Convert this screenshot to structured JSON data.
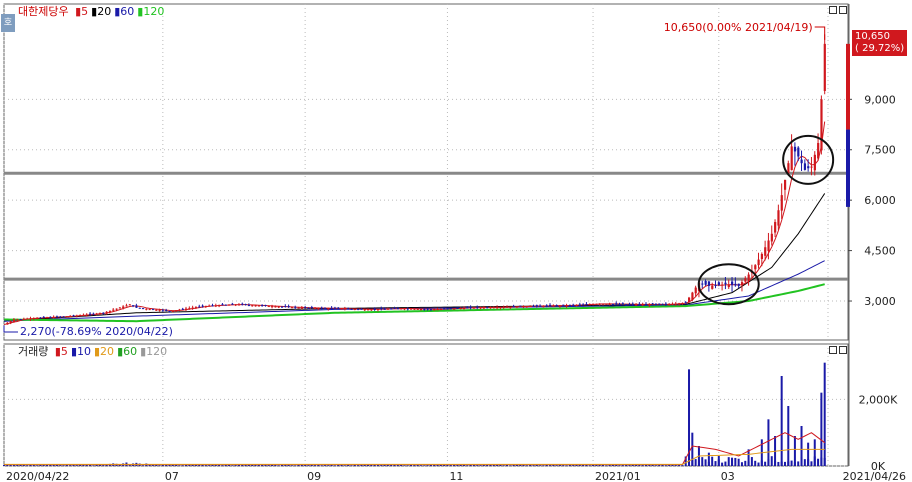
{
  "stock": {
    "name": "대한제당우"
  },
  "price_legend": [
    {
      "label": "5",
      "color": "#d0181e"
    },
    {
      "label": "20",
      "color": "#000000"
    },
    {
      "label": "60",
      "color": "#1a1aa8"
    },
    {
      "label": "120",
      "color": "#22c322"
    }
  ],
  "volume_legend": {
    "title": "거래량",
    "items": [
      {
        "label": "5",
        "color": "#d0181e"
      },
      {
        "label": "10",
        "color": "#1a1aa8"
      },
      {
        "label": "20",
        "color": "#e09a1a"
      },
      {
        "label": "60",
        "color": "#22a022"
      },
      {
        "label": "120",
        "color": "#999999"
      }
    ]
  },
  "annotations": {
    "high": "10,650(0.00% 2021/04/19)",
    "low": "2,270(-78.69% 2020/04/22)"
  },
  "price_tag": {
    "line1": "10,650",
    "line2": "( 29.72%)"
  },
  "corner_icon": "호",
  "chart_data": [
    {
      "type": "candlestick",
      "y_ticks": [
        "9,000",
        "7,500",
        "6,000",
        "4,500",
        "3,000"
      ],
      "y_tick_values": [
        9000,
        7500,
        6000,
        4500,
        3000
      ],
      "ylim": [
        1900,
        11300
      ],
      "x_ticks": [
        "2020/04/22",
        "07",
        "09",
        "11",
        "2021/01",
        "03",
        "2021/04/26"
      ],
      "x_tick_index": [
        0,
        48,
        91,
        134,
        178,
        216,
        249
      ],
      "horizontal_lines": [
        6800,
        3650
      ],
      "close_points": [
        [
          0,
          2300
        ],
        [
          3,
          2450
        ],
        [
          10,
          2500
        ],
        [
          20,
          2550
        ],
        [
          30,
          2650
        ],
        [
          38,
          2900
        ],
        [
          40,
          2800
        ],
        [
          50,
          2700
        ],
        [
          60,
          2850
        ],
        [
          70,
          2900
        ],
        [
          80,
          2850
        ],
        [
          90,
          2800
        ],
        [
          100,
          2780
        ],
        [
          110,
          2750
        ],
        [
          120,
          2780
        ],
        [
          130,
          2750
        ],
        [
          140,
          2800
        ],
        [
          150,
          2820
        ],
        [
          160,
          2850
        ],
        [
          170,
          2870
        ],
        [
          180,
          2920
        ],
        [
          190,
          2900
        ],
        [
          200,
          2900
        ],
        [
          206,
          2950
        ],
        [
          210,
          3550
        ],
        [
          213,
          3450
        ],
        [
          218,
          3500
        ],
        [
          222,
          3450
        ],
        [
          226,
          3900
        ],
        [
          229,
          4400
        ],
        [
          232,
          5000
        ],
        [
          234,
          5700
        ],
        [
          236,
          6600
        ],
        [
          238,
          7600
        ],
        [
          240,
          7300
        ],
        [
          242,
          6900
        ],
        [
          244,
          7000
        ],
        [
          246,
          7700
        ],
        [
          247,
          9000
        ],
        [
          248,
          10650
        ]
      ],
      "ma": [
        {
          "label": "20",
          "points": [
            [
              0,
              2400
            ],
            [
              40,
              2650
            ],
            [
              100,
              2780
            ],
            [
              206,
              2900
            ],
            [
              220,
              3250
            ],
            [
              232,
              4000
            ],
            [
              240,
              5000
            ],
            [
              248,
              6200
            ]
          ]
        },
        {
          "label": "60",
          "points": [
            [
              0,
              2400
            ],
            [
              40,
              2550
            ],
            [
              100,
              2750
            ],
            [
              206,
              2880
            ],
            [
              225,
              3150
            ],
            [
              240,
              3800
            ],
            [
              248,
              4200
            ]
          ]
        },
        {
          "label": "120",
          "points": [
            [
              0,
              2450
            ],
            [
              40,
              2400
            ],
            [
              100,
              2650
            ],
            [
              206,
              2850
            ],
            [
              225,
              3000
            ],
            [
              240,
              3300
            ],
            [
              248,
              3500
            ]
          ]
        }
      ]
    },
    {
      "type": "bar",
      "title": "거래량",
      "y_ticks": [
        "2,000K",
        "0K"
      ],
      "y_tick_values": [
        2000,
        0
      ],
      "ylim": [
        0,
        3300
      ],
      "spikes": [
        [
          207,
          2900
        ],
        [
          208,
          1000
        ],
        [
          210,
          600
        ],
        [
          213,
          400
        ],
        [
          216,
          300
        ],
        [
          220,
          250
        ],
        [
          225,
          500
        ],
        [
          229,
          800
        ],
        [
          231,
          1400
        ],
        [
          233,
          900
        ],
        [
          235,
          2700
        ],
        [
          237,
          1800
        ],
        [
          239,
          900
        ],
        [
          241,
          1200
        ],
        [
          243,
          700
        ],
        [
          245,
          800
        ],
        [
          247,
          2200
        ],
        [
          248,
          3100
        ]
      ]
    }
  ]
}
